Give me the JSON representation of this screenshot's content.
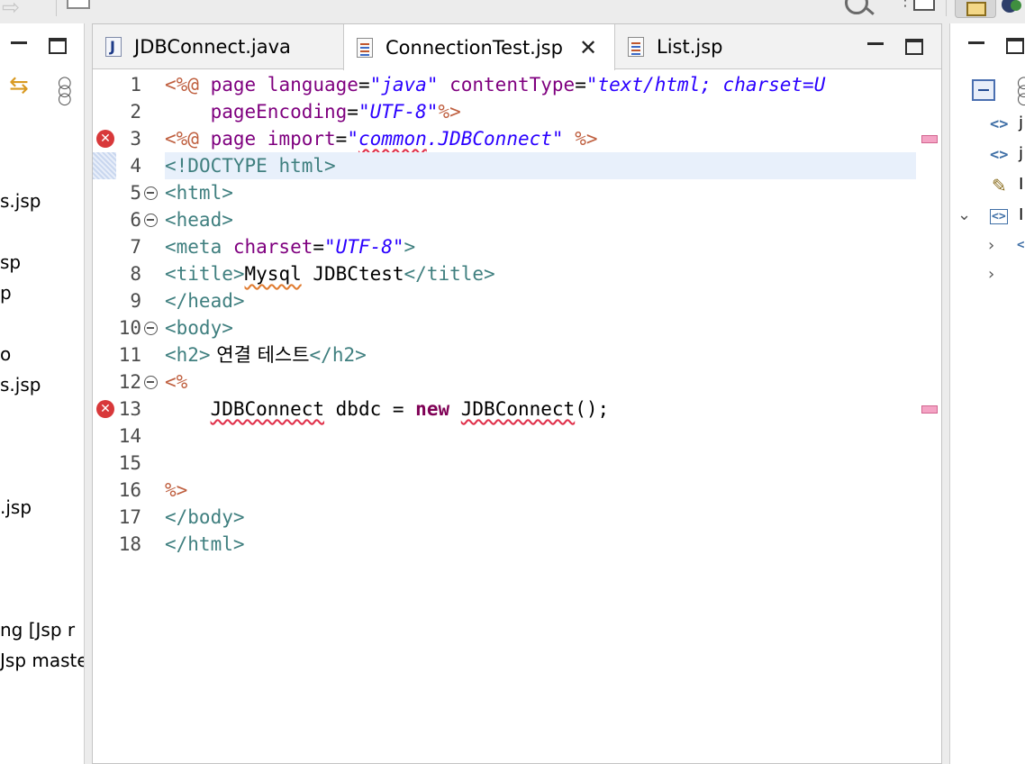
{
  "editor": {
    "tabs": [
      {
        "label": "JDBConnect.java",
        "icon": "java-file-icon",
        "active": false
      },
      {
        "label": "ConnectionTest.jsp",
        "icon": "jsp-file-icon",
        "active": true
      },
      {
        "label": "List.jsp",
        "icon": "jsp-file-icon",
        "active": false
      }
    ],
    "lines": [
      {
        "num": "1"
      },
      {
        "num": "2"
      },
      {
        "num": "3",
        "error": true
      },
      {
        "num": "4",
        "current": true
      },
      {
        "num": "5",
        "fold": true
      },
      {
        "num": "6",
        "fold": true
      },
      {
        "num": "7"
      },
      {
        "num": "8"
      },
      {
        "num": "9"
      },
      {
        "num": "10",
        "fold": true
      },
      {
        "num": "11"
      },
      {
        "num": "12",
        "fold": true
      },
      {
        "num": "13",
        "error": true
      },
      {
        "num": "14"
      },
      {
        "num": "15"
      },
      {
        "num": "16"
      },
      {
        "num": "17"
      },
      {
        "num": "18"
      }
    ],
    "code": {
      "l1": {
        "open": "<%@",
        "kw": " page ",
        "a1": "language",
        "eq1": "=",
        "v1": "\"java\"",
        "a2": " contentType",
        "eq2": "=",
        "v2": "\"text/html; charset=U"
      },
      "l2": {
        "indent": "    ",
        "a1": "pageEncoding",
        "eq1": "=",
        "v1": "\"UTF-8\"",
        "close": "%>"
      },
      "l3": {
        "open": "<%@",
        "kw": " page ",
        "a1": "import",
        "eq1": "=",
        "q1": "\"",
        "v1": "common",
        "v1b": ".JDBConnect",
        "q2": "\"",
        "close": " %>"
      },
      "l4": {
        "open": "<",
        "tag": "!DOCTYPE html>"
      },
      "l5": {
        "tag": "<html>"
      },
      "l6": {
        "tag": "<head>"
      },
      "l7": {
        "tag": "<meta",
        "a1": " charset",
        "eq1": "=",
        "v1": "\"UTF-8\"",
        "close": ">"
      },
      "l8": {
        "tag": "<title>",
        "text1": "Mysql",
        "text2": " JDBCtest",
        "tag2": "</title>"
      },
      "l9": {
        "tag": "</head>"
      },
      "l10": {
        "tag": "<body>"
      },
      "l11": {
        "tag": "<h2>",
        "text": " 연결 테스트",
        "tag2": "</h2>"
      },
      "l12": {
        "open": "<%"
      },
      "l13": {
        "indent": "    ",
        "t1": "JDBConnect",
        "t2": " dbdc = ",
        "kw": "new",
        "t3": " ",
        "t4": "JDBConnect",
        "t5": "();"
      },
      "l16": {
        "close": "%>"
      },
      "l17": {
        "tag": "</body>"
      },
      "l18": {
        "tag": "</html>"
      }
    }
  },
  "left_panel": {
    "items": [
      {
        "label": "s.jsp",
        "top": 0
      },
      {
        "label": "sp"
      },
      {
        "label": "p"
      },
      {
        "label": "o"
      },
      {
        "label": "s.jsp"
      },
      {
        "label": ".jsp"
      },
      {
        "label": "ng [Jsp r"
      },
      {
        "label": "Jsp maste"
      }
    ]
  },
  "right_panel": {
    "items": [
      {
        "icon": "tag-icon",
        "label": "j"
      },
      {
        "icon": "tag-icon",
        "label": "j"
      },
      {
        "icon": "brush-icon",
        "label": "I"
      },
      {
        "icon": "tag-icon",
        "label": "I"
      }
    ]
  },
  "colors": {
    "jsp_delimiter": "#bf5f3f",
    "tag": "#3f7f7f",
    "attribute": "#7f007f",
    "string": "#2a00ff",
    "keyword": "#7f0055",
    "error": "#d8383a",
    "current_line": "#e8f0fb"
  }
}
